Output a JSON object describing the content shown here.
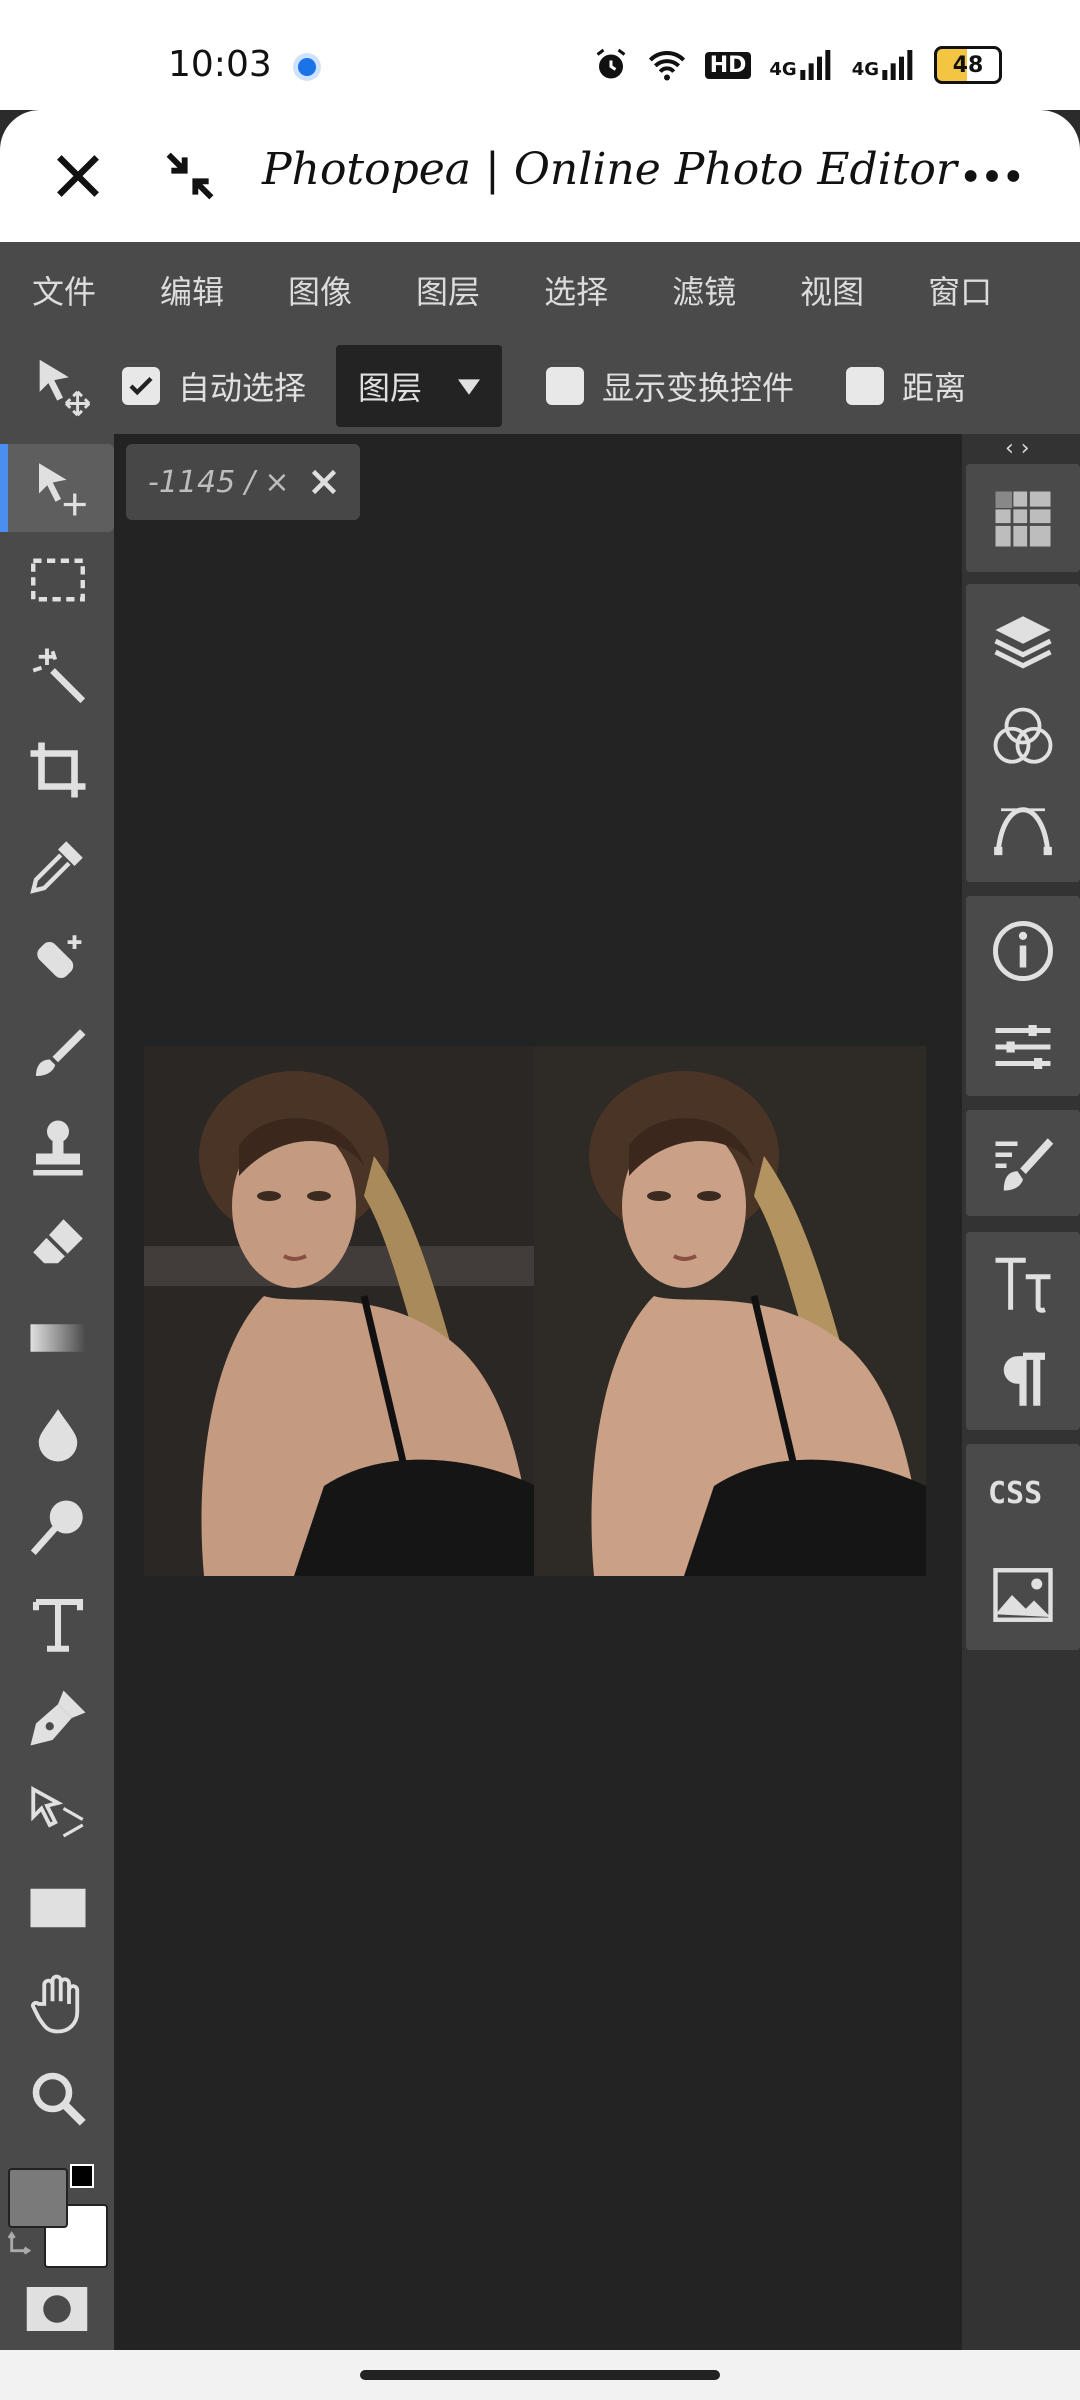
{
  "status_bar": {
    "time": "10:03",
    "icons": [
      "alarm-icon",
      "wifi-icon",
      "hd-icon",
      "4g-signal-icon",
      "4g-signal-icon",
      "battery-icon"
    ],
    "hd_label": "HD",
    "network_label_1": "4G",
    "network_label_2": "4G",
    "battery": "48"
  },
  "browser": {
    "title": "Photopea | Online Photo Editor"
  },
  "menu": {
    "items": [
      "文件",
      "编辑",
      "图像",
      "图层",
      "选择",
      "滤镜",
      "视图",
      "窗口"
    ]
  },
  "options": {
    "auto_select_label": "自动选择",
    "auto_select_checked": true,
    "layer_select_value": "图层",
    "show_transform_label": "显示变换控件",
    "distance_label": "距离"
  },
  "document": {
    "tab_label": "-1145 /",
    "tab_star": "×"
  },
  "panels": {
    "css_label": "CSS"
  },
  "colors": {
    "foreground": "#7a7a7a",
    "background": "#ffffff",
    "accent": "#4a8ff0"
  }
}
